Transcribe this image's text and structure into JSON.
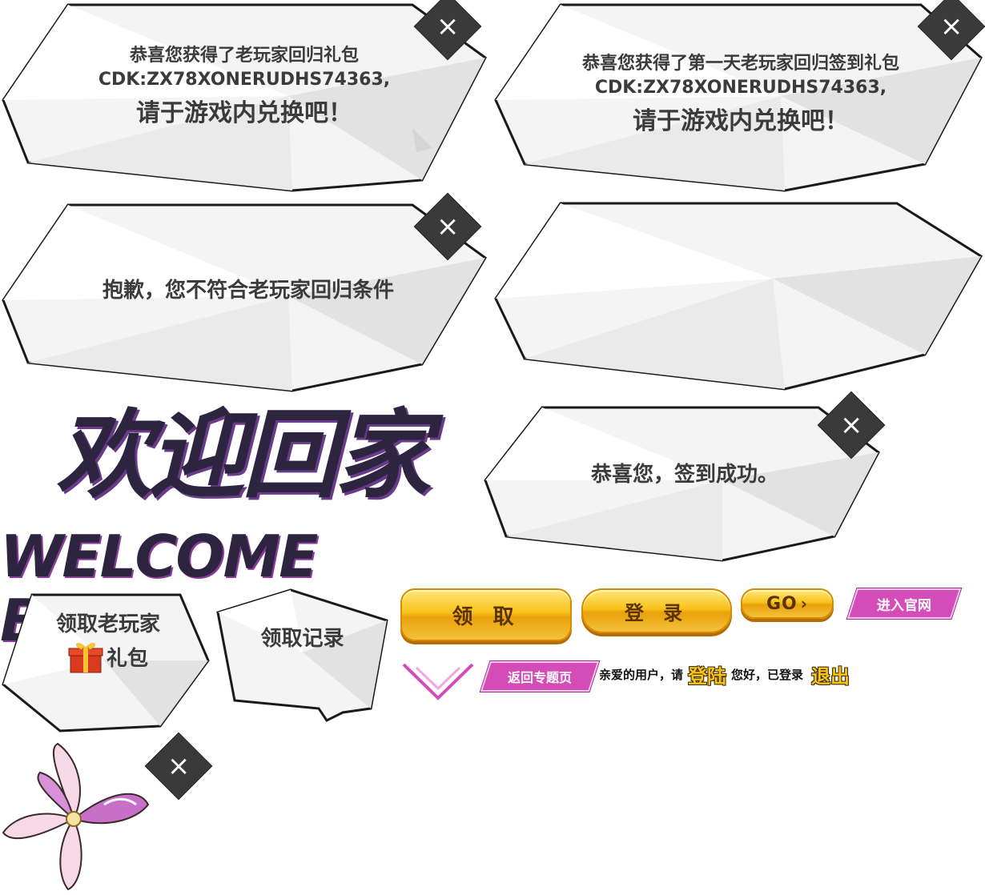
{
  "panels": {
    "p1": {
      "line1": "恭喜您获得了老玩家回归礼包",
      "line2": "CDK:ZX78XONERUDHS74363,",
      "line3": "请于游戏内兑换吧！"
    },
    "p2": {
      "line1": "恭喜您获得了第一天老玩家回归签到礼包",
      "line2": "CDK:ZX78XONERUDHS74363,",
      "line3": "请于游戏内兑换吧！"
    },
    "p3": {
      "line1": "抱歉，您不符合老玩家回归条件"
    },
    "p5": {
      "line1": "恭喜您，签到成功。"
    }
  },
  "logo": {
    "title_cn": "欢迎回家",
    "title_en": "WELCOME BACK"
  },
  "claim_box": {
    "line1": "领取老玩家",
    "line2": "礼包"
  },
  "record_box": {
    "label": "领取记录"
  },
  "buttons": {
    "claim": "领 取",
    "login": "登 录",
    "go": "GO",
    "official": "进入官网",
    "back_topic": "返回专题页"
  },
  "status_bar": {
    "greet": "亲爱的用户，请",
    "login_link": "登陆",
    "logged_in": "您好，已登录",
    "logout_link": "退出"
  },
  "close_glyph": "×",
  "colors": {
    "gold": "#f8c21a",
    "pink": "#d44cb8",
    "dark": "#3a3a3a",
    "purple": "#2d2440"
  }
}
